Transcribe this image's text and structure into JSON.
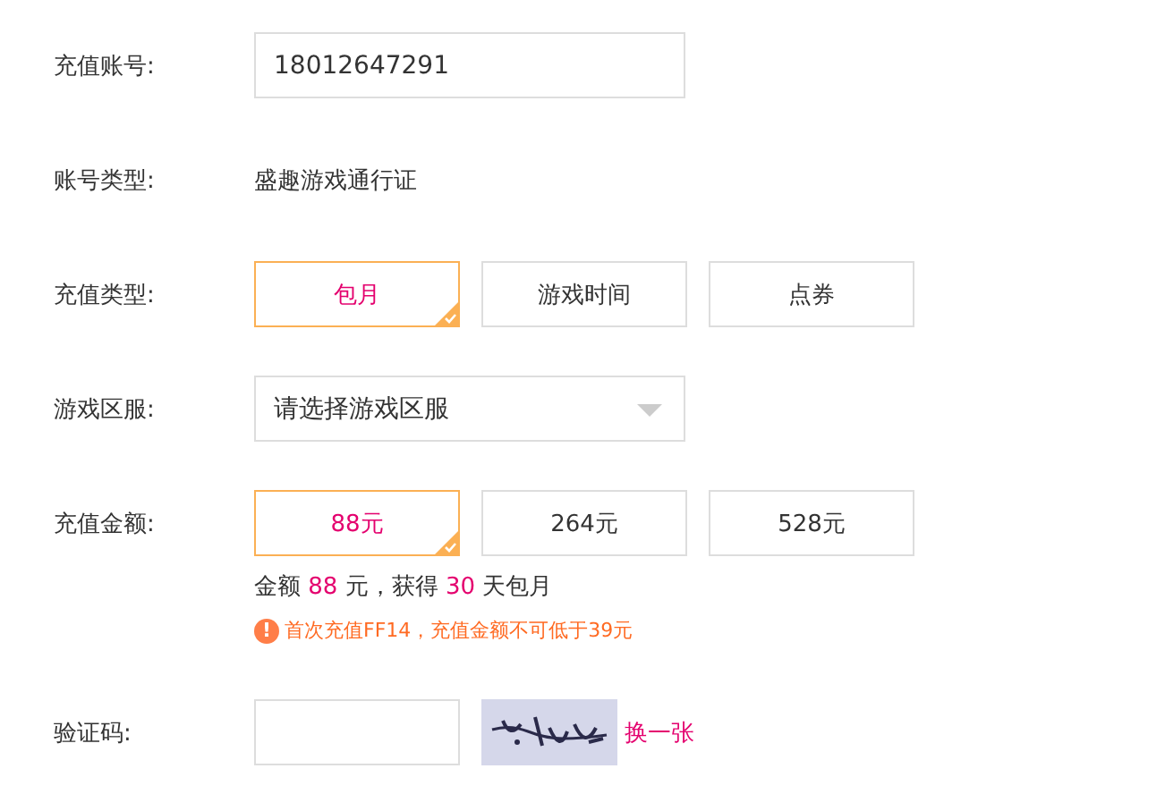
{
  "account": {
    "label": "充值账号:",
    "value": "18012647291"
  },
  "account_type": {
    "label": "账号类型:",
    "value": "盛趣游戏通行证"
  },
  "recharge_type": {
    "label": "充值类型:",
    "options": [
      {
        "label": "包月",
        "selected": true
      },
      {
        "label": "游戏时间",
        "selected": false
      },
      {
        "label": "点券",
        "selected": false
      }
    ]
  },
  "server": {
    "label": "游戏区服:",
    "placeholder": "请选择游戏区服"
  },
  "amount": {
    "label": "充值金额:",
    "options": [
      {
        "label": "88元",
        "selected": true
      },
      {
        "label": "264元",
        "selected": false
      },
      {
        "label": "528元",
        "selected": false
      }
    ],
    "summary": [
      {
        "text": "金额 ",
        "highlight": false
      },
      {
        "text": "88",
        "highlight": true
      },
      {
        "text": " 元，获得 ",
        "highlight": false
      },
      {
        "text": "30",
        "highlight": true
      },
      {
        "text": " 天包月",
        "highlight": false
      }
    ],
    "warning": {
      "icon": "!",
      "text": "首次充值FF14，充值金额不可低于39元"
    }
  },
  "captcha": {
    "label": "验证码:",
    "refresh": "换一张"
  }
}
